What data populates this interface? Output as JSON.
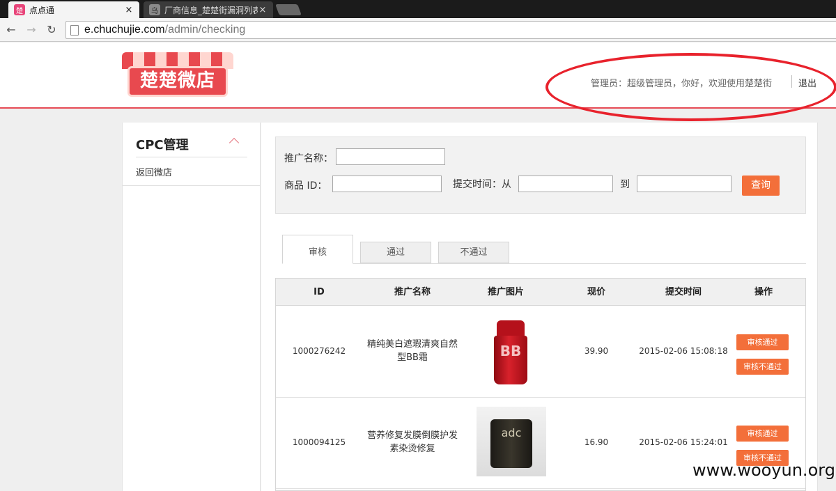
{
  "browser": {
    "tabs": [
      {
        "favicon": "楚",
        "title": "点点通",
        "close": "×"
      },
      {
        "favicon": "乌",
        "title": "厂商信息_楚楚街漏洞列表",
        "close": "×"
      }
    ],
    "url_domain": "e.chuchujie.com",
    "url_path": "/admin/checking"
  },
  "header": {
    "logo_text": "楚楚微店",
    "welcome": "管理员：超级管理员，你好，欢迎使用楚楚街",
    "logout": "退出"
  },
  "sidebar": {
    "title": "CPC管理",
    "link": "返回微店"
  },
  "search": {
    "promo_name_label": "推广名称：",
    "product_id_label": "商品 ID：",
    "submit_time_label": "提交时间：从",
    "to_label": "到",
    "query_button": "查询"
  },
  "tabs": [
    "审核",
    "通过",
    "不通过"
  ],
  "table": {
    "columns": [
      "ID",
      "推广名称",
      "推广图片",
      "现价",
      "提交时间",
      "操作"
    ],
    "rows": [
      {
        "id": "1000276242",
        "name": "精纯美白遮瑕清爽自然型BB霜",
        "image": "bb-cream-product-image",
        "price": "39.90",
        "time": "2015-02-06 15:08:18",
        "approve": "审核通过",
        "reject": "审核不通过",
        "image_text": "BB"
      },
      {
        "id": "1000094125",
        "name": "营养修复发膜倒膜护发素染烫修复",
        "image": "adc-hair-mask-product-image",
        "price": "16.90",
        "time": "2015-02-06 15:24:01",
        "approve": "审核通过",
        "reject": "审核不通过",
        "image_text": "adc"
      }
    ]
  },
  "watermark": "www.wooyun.org",
  "colors": {
    "accent": "#f36f3a",
    "brand": "#e8494f",
    "annotation": "#e8222c"
  }
}
